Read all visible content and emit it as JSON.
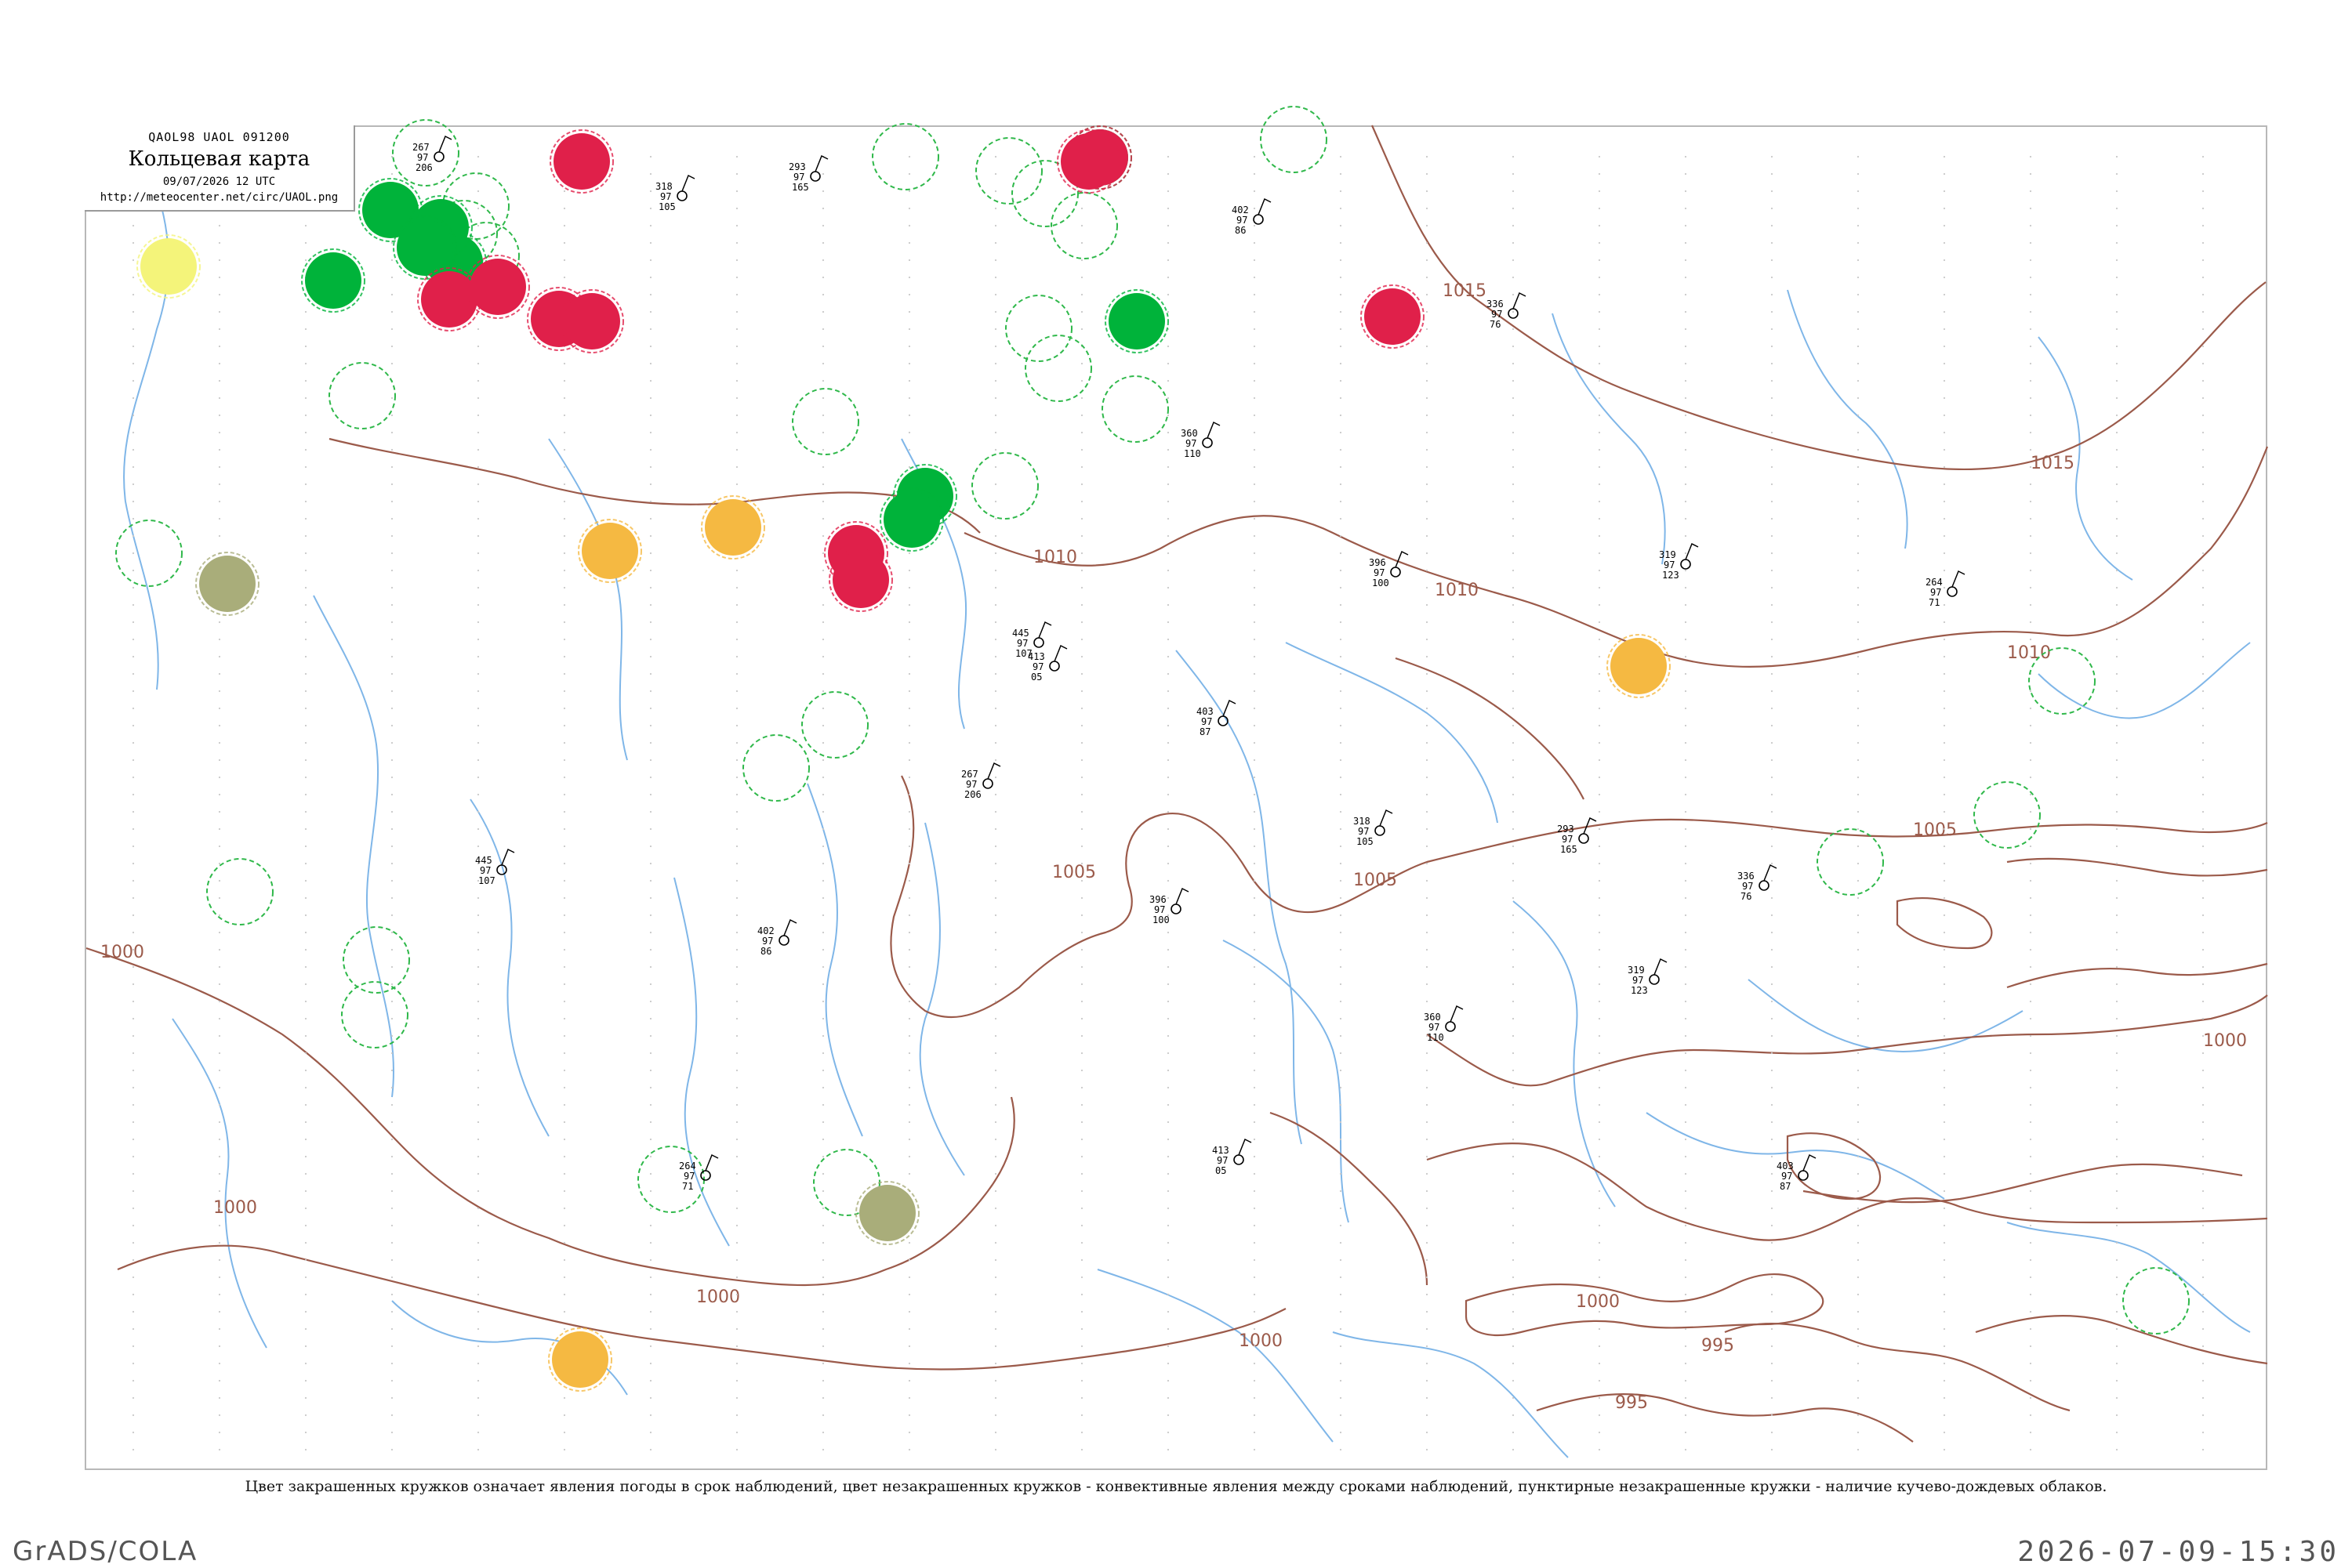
{
  "header": {
    "code": "QAOL98  UAOL  091200",
    "title": "Кольцевая карта",
    "date": "09/07/2026 12 UTC",
    "url": "http://meteocenter.net/circ/UAOL.png"
  },
  "legend_note": "Цвет закрашенных кружков означает явления погоды в срок наблюдений, цвет незакрашенных кружков - конвективные явления между сроками наблюдений, пунктирные незакрашенные кружки - наличие кучево-дождевых облаков.",
  "footer": {
    "left": "GrADS/COLA",
    "right": "2026-07-09-15:30"
  },
  "colors": {
    "green": "#00b33a",
    "red": "#e0204a",
    "orange": "#f5b942",
    "olive": "#a9ad7a",
    "yellow": "#f4f47a",
    "isobar": "#9b5a4a",
    "river": "#7fb6e8",
    "cb_dashed": "#2fb84a"
  },
  "isobar_labels": [
    "1015",
    "1015",
    "1010",
    "1010",
    "1010",
    "1005",
    "1005",
    "1005",
    "1000",
    "1000",
    "1000",
    "1000",
    "1000",
    "1000",
    "995",
    "995"
  ],
  "filled_stations": [
    {
      "color": "green",
      "name": ""
    },
    {
      "color": "green",
      "name": ""
    },
    {
      "color": "green",
      "name": ""
    },
    {
      "color": "green",
      "name": ""
    },
    {
      "color": "green",
      "name": ""
    },
    {
      "color": "green",
      "name": ""
    },
    {
      "color": "green",
      "name": ""
    },
    {
      "color": "green",
      "name": ""
    },
    {
      "color": "green",
      "name": ""
    },
    {
      "color": "red",
      "name": ""
    },
    {
      "color": "red",
      "name": ""
    },
    {
      "color": "red",
      "name": ""
    },
    {
      "color": "red",
      "name": ""
    },
    {
      "color": "red",
      "name": ""
    },
    {
      "color": "red",
      "name": ""
    },
    {
      "color": "red",
      "name": ""
    },
    {
      "color": "red",
      "name": ""
    },
    {
      "color": "red",
      "name": ""
    },
    {
      "color": "red",
      "name": ""
    },
    {
      "color": "orange",
      "name": ""
    },
    {
      "color": "orange",
      "name": ""
    },
    {
      "color": "orange",
      "name": ""
    },
    {
      "color": "orange",
      "name": ""
    },
    {
      "color": "olive",
      "name": ""
    },
    {
      "color": "olive",
      "name": ""
    },
    {
      "color": "yellow",
      "name": ""
    }
  ],
  "station_samples": [
    {
      "p": "267",
      "t": "97",
      "d": "206"
    },
    {
      "p": "318",
      "t": "97",
      "d": "105"
    },
    {
      "p": "293",
      "t": "97",
      "d": "165"
    },
    {
      "p": "402",
      "t": "97",
      "d": "86"
    },
    {
      "p": "336",
      "t": "97",
      "d": "76"
    },
    {
      "p": "360",
      "t": "97",
      "d": "110"
    },
    {
      "p": "319",
      "t": "97",
      "d": "123"
    },
    {
      "p": "413",
      "t": "97",
      "d": "05"
    },
    {
      "p": "396",
      "t": "97",
      "d": "100"
    },
    {
      "p": "445",
      "t": "97",
      "d": "107"
    },
    {
      "p": "403",
      "t": "97",
      "d": "87"
    },
    {
      "p": "264",
      "t": "97",
      "d": "71"
    }
  ]
}
